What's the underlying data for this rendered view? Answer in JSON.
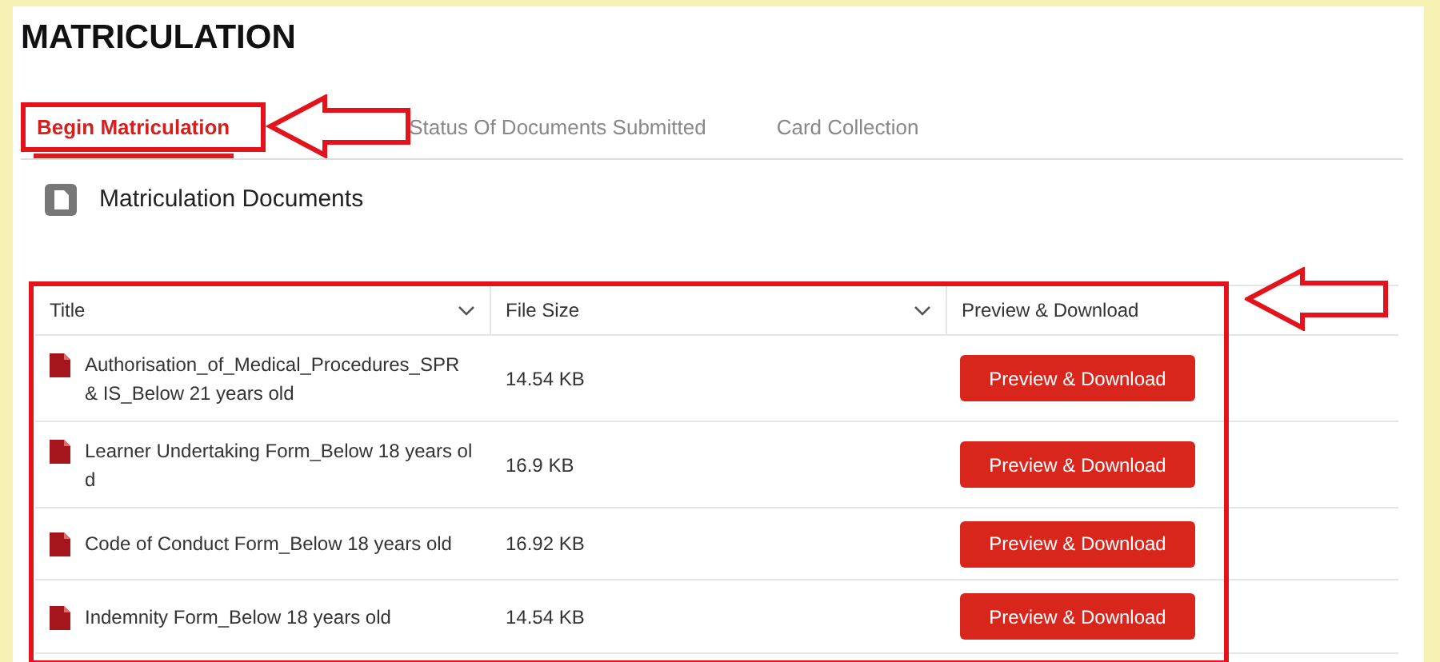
{
  "page": {
    "title": "MATRICULATION"
  },
  "tabs": [
    {
      "label": "Begin Matriculation",
      "selected": true
    },
    {
      "label": "Status Of Documents Submitted",
      "selected": false
    },
    {
      "label": "Card Collection",
      "selected": false
    }
  ],
  "section": {
    "title": "Matriculation Documents"
  },
  "table": {
    "columns": [
      {
        "label": "Title",
        "sortable": true
      },
      {
        "label": "File Size",
        "sortable": true
      },
      {
        "label": "Preview & Download",
        "sortable": false
      }
    ],
    "rows": [
      {
        "title": "Authorisation_of_Medical_Procedures_SPR & IS_Below 21 years old",
        "size": "14.54 KB",
        "action": "Preview & Download"
      },
      {
        "title": "Learner Undertaking Form_Below 18 years old",
        "size": "16.9 KB",
        "action": "Preview & Download"
      },
      {
        "title": "Code of Conduct Form_Below 18 years old",
        "size": "16.92 KB",
        "action": "Preview & Download"
      },
      {
        "title": "Indemnity Form_Below 18 years old",
        "size": "14.54 KB",
        "action": "Preview & Download"
      }
    ]
  }
}
